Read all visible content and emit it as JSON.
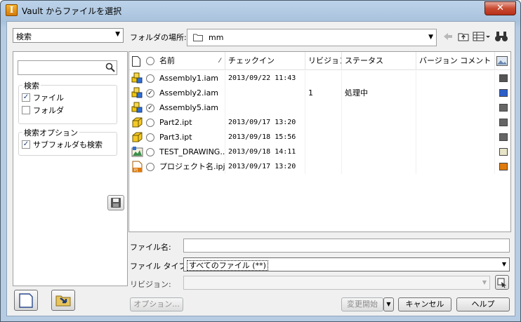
{
  "window": {
    "title": "Vault からファイルを選択",
    "close_label": "✕"
  },
  "left": {
    "search_mode": "検索",
    "search_placeholder": "",
    "search_group_title": "検索",
    "files_label": "ファイル",
    "files_checked": true,
    "folders_label": "フォルダ",
    "folders_checked": false,
    "options_group_title": "検索オプション",
    "subfolders_label": "サブフォルダも検索",
    "subfolders_checked": true
  },
  "location": {
    "label": "フォルダの場所:",
    "path": "mm"
  },
  "columns": [
    "名前",
    "チェックイン",
    "リビジョン",
    "ステータス",
    "バージョン コメント"
  ],
  "files": [
    {
      "name": "Assembly1.iam",
      "checkin": "2013/09/22 11:43",
      "revision": "",
      "status": "",
      "icon": "assembly-icon",
      "checked": false
    },
    {
      "name": "Assembly2.iam",
      "checkin": "",
      "revision": "1",
      "status": "処理中",
      "icon": "assembly-icon",
      "checked": true
    },
    {
      "name": "Assembly5.iam",
      "checkin": "",
      "revision": "",
      "status": "",
      "icon": "assembly-icon",
      "checked": true
    },
    {
      "name": "Part2.ipt",
      "checkin": "2013/09/17 13:20",
      "revision": "",
      "status": "",
      "icon": "part-icon",
      "checked": false
    },
    {
      "name": "Part3.ipt",
      "checkin": "2013/09/18 15:56",
      "revision": "",
      "status": "",
      "icon": "part-icon",
      "checked": false
    },
    {
      "name": "TEST_DRAWING....",
      "checkin": "2013/09/18 14:11",
      "revision": "",
      "status": "",
      "icon": "drawing-icon",
      "checked": false
    },
    {
      "name": "プロジェクト名.ipj",
      "checkin": "2013/09/17 13:20",
      "revision": "",
      "status": "",
      "icon": "project-icon",
      "checked": false
    }
  ],
  "form": {
    "filename_label": "ファイル名:",
    "filename_value": "",
    "filetype_label": "ファイル タイプ:",
    "filetype_value": "すべてのファイル (**)",
    "revision_label": "リビジョン:",
    "revision_value": ""
  },
  "buttons": {
    "options": "オプション...",
    "start_change": "変更開始",
    "cancel": "キャンセル",
    "help": "ヘルプ"
  },
  "colors": {
    "title_bg": "#b9d1ea",
    "close": "#c84a31",
    "accent": "#1f3b78"
  }
}
